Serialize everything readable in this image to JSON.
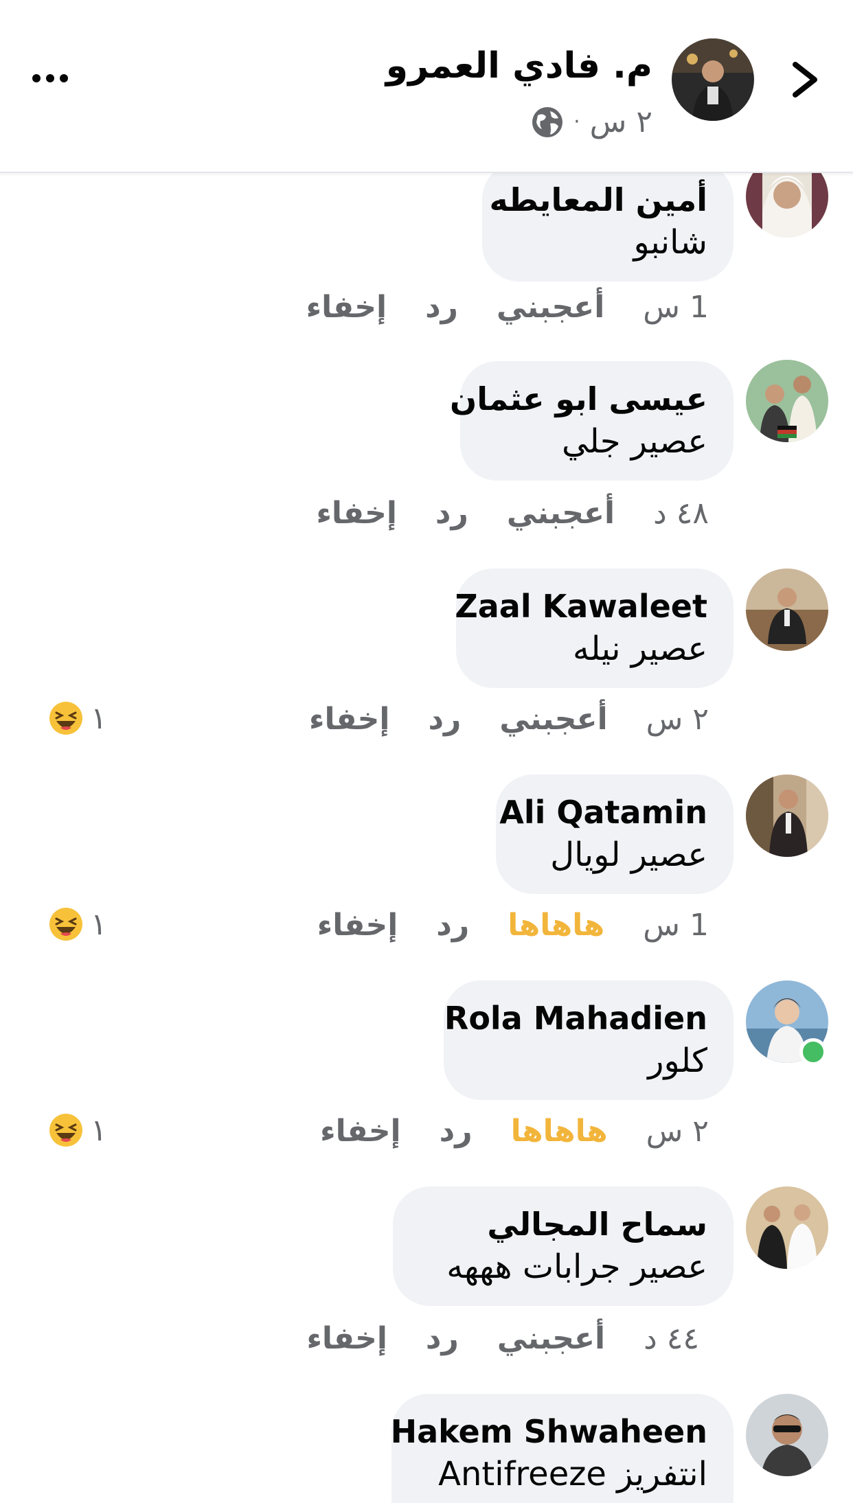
{
  "header": {
    "name": "م. فادي العمرو",
    "time": "٢ س",
    "separator": "·"
  },
  "comments": [
    {
      "author": "أمين المعايطه",
      "text": "شانبو",
      "time": "1 س",
      "like_label": "أعجبني",
      "reply_label": "رد",
      "hide_label": "إخفاء",
      "reaction_count": ""
    },
    {
      "author": "عيسى ابو عثمان",
      "text": "عصير جلي",
      "time": "٤٨ د",
      "like_label": "أعجبني",
      "reply_label": "رد",
      "hide_label": "إخفاء",
      "reaction_count": ""
    },
    {
      "author": "Zaal Kawaleet",
      "text": "عصير نيله",
      "time": "٢ س",
      "like_label": "أعجبني",
      "reply_label": "رد",
      "hide_label": "إخفاء",
      "reaction_count": "١"
    },
    {
      "author": "Ali Qatamin",
      "text": "عصير لويال",
      "time": "1 س",
      "like_label": "هاهاها",
      "reply_label": "رد",
      "hide_label": "إخفاء",
      "reaction_count": "١"
    },
    {
      "author": "Rola Mahadien",
      "text": "كلور",
      "time": "٢ س",
      "like_label": "هاهاها",
      "reply_label": "رد",
      "hide_label": "إخفاء",
      "reaction_count": "١"
    },
    {
      "author": "سماح المجالي",
      "text": "عصير جرابات هههه",
      "time": "٤٤ د",
      "like_label": "أعجبني",
      "reply_label": "رد",
      "hide_label": "إخفاء",
      "reaction_count": ""
    },
    {
      "author": "Hakem Shwaheen",
      "text": "انتفريز Antifreeze",
      "time": "",
      "like_label": "",
      "reply_label": "",
      "hide_label": "",
      "reaction_count": ""
    }
  ],
  "colors": {
    "bubble": "#f0f2f5",
    "secondary_text": "#65676b",
    "haha": "#f2b53b",
    "online": "#45bd62"
  },
  "icons": {
    "back": "chevron-right-icon",
    "more": "more-icon",
    "privacy": "globe-icon",
    "reaction": "haha-emoji-icon"
  }
}
